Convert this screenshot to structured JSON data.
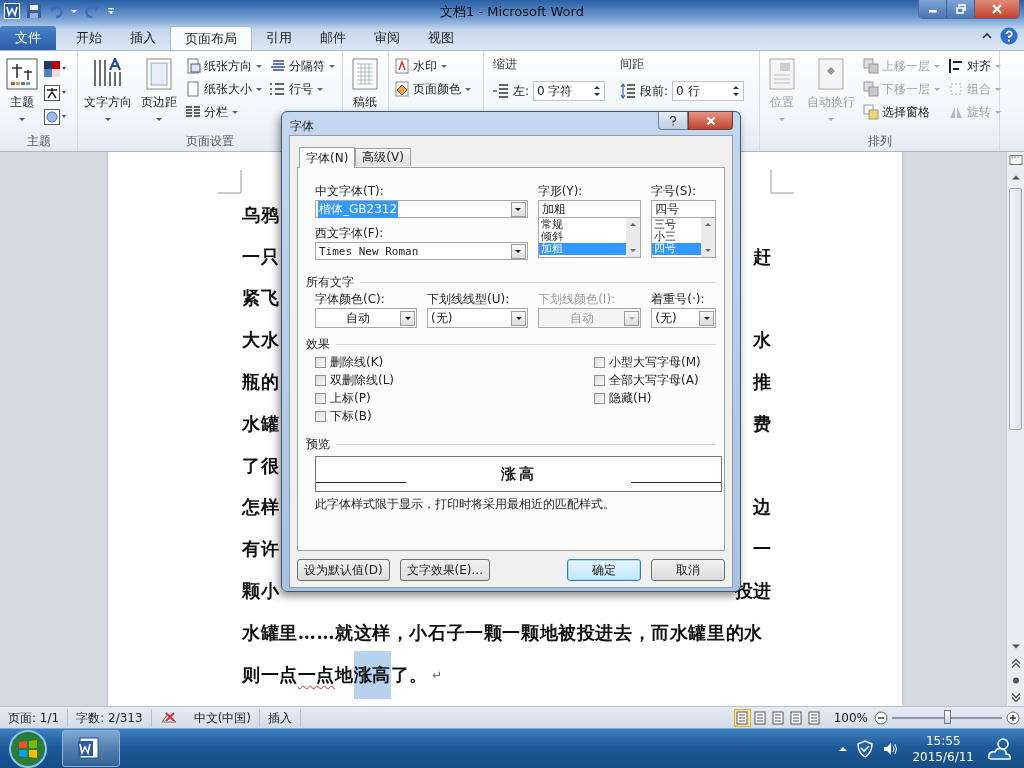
{
  "window": {
    "title": "文档1 - Microsoft Word"
  },
  "ribbon_tabs": [
    {
      "label": "文件",
      "kind": "file",
      "selected": false
    },
    {
      "label": "开始",
      "kind": "tab",
      "selected": false
    },
    {
      "label": "插入",
      "kind": "tab",
      "selected": false
    },
    {
      "label": "页面布局",
      "kind": "tab",
      "selected": true
    },
    {
      "label": "引用",
      "kind": "tab",
      "selected": false
    },
    {
      "label": "邮件",
      "kind": "tab",
      "selected": false
    },
    {
      "label": "审阅",
      "kind": "tab",
      "selected": false
    },
    {
      "label": "视图",
      "kind": "tab",
      "selected": false
    }
  ],
  "ribbon": {
    "themes": {
      "label": "主题",
      "button": "主题"
    },
    "page_setup": {
      "label": "页面设置",
      "large_buttons": [
        "文字方向",
        "页边距"
      ],
      "small_buttons": [
        "纸张方向",
        "纸张大小",
        "分栏",
        "分隔符",
        "行号"
      ]
    },
    "manuscript": {
      "button": "稿纸"
    },
    "page_background": {
      "small_buttons": [
        "水印",
        "页面颜色"
      ]
    },
    "paragraph": {
      "indent_label": "缩进",
      "indent_left": {
        "label": "左:",
        "value": "0 字符"
      },
      "spacing_label": "间距",
      "spacing_before": {
        "label": "段前:",
        "value": "0 行"
      }
    },
    "arrange": {
      "label": "排列",
      "large_buttons": [
        {
          "label": "位置",
          "disabled": true
        },
        {
          "label": "自动换行",
          "disabled": true
        }
      ],
      "small_buttons": [
        {
          "label": "上移一层",
          "disabled": true
        },
        {
          "label": "下移一层",
          "disabled": true
        },
        {
          "label": "选择窗格",
          "disabled": false
        },
        {
          "label": "对齐",
          "disabled": false
        },
        {
          "label": "组合",
          "disabled": true
        },
        {
          "label": "旋转",
          "disabled": true
        }
      ]
    }
  },
  "document": {
    "lines": [
      {
        "kind": "split",
        "left": "乌鸦"
      },
      {
        "kind": "split",
        "left": "一只",
        "right": "赶"
      },
      {
        "kind": "split",
        "left": "紧飞"
      },
      {
        "kind": "split",
        "left": "大水",
        "right": "水"
      },
      {
        "kind": "split",
        "left": "瓶的",
        "right": "推"
      },
      {
        "kind": "split",
        "left": "水罐",
        "right": "费"
      },
      {
        "kind": "split",
        "left": "了很"
      },
      {
        "kind": "split",
        "left": "怎样",
        "right": "边"
      },
      {
        "kind": "split",
        "left": "有许",
        "right": "一"
      },
      {
        "kind": "split",
        "left": "颗小",
        "right": "投进"
      },
      {
        "kind": "full",
        "text": "水罐里……就这样，小石子一颗一颗地被投进去，而水罐里的水"
      },
      {
        "kind": "segments",
        "segments": [
          {
            "text": "则一点",
            "selected": false,
            "misspelled": false
          },
          {
            "text": "一点",
            "selected": false,
            "misspelled": true
          },
          {
            "text": "地",
            "selected": false,
            "misspelled": false
          },
          {
            "text": "涨高",
            "selected": true,
            "misspelled": false
          },
          {
            "text": "了。",
            "selected": false,
            "misspelled": false
          }
        ],
        "paragraph_mark": "↵"
      }
    ]
  },
  "status_bar": {
    "page": "页面: 1/1",
    "words": "字数: 2/313",
    "language": "中文(中国)",
    "mode": "插入",
    "views": [
      {
        "selected": true
      },
      {
        "selected": false
      },
      {
        "selected": false
      },
      {
        "selected": false
      },
      {
        "selected": false
      }
    ],
    "zoom": "100%",
    "zoom_slider": {
      "level": 0.5
    }
  },
  "taskbar": {
    "time": "15:55",
    "date": "2015/6/11"
  },
  "dialog": {
    "title": "字体",
    "tabs": [
      {
        "label": "字体(N)",
        "selected": true
      },
      {
        "label": "高级(V)",
        "selected": false
      }
    ],
    "chinese_font": {
      "label": "中文字体(T):",
      "value": "楷体_GB2312",
      "value_selected": true
    },
    "western_font": {
      "label": "西文字体(F):",
      "value": "Times New Roman",
      "value_selected": false
    },
    "style": {
      "label": "字形(Y):",
      "value": "加粗",
      "options": [
        {
          "label": "常规",
          "selected": false
        },
        {
          "label": "倾斜",
          "selected": false
        },
        {
          "label": "加粗",
          "selected": true
        }
      ]
    },
    "size": {
      "label": "字号(S):",
      "value": "四号",
      "options": [
        {
          "label": "三号",
          "selected": false
        },
        {
          "label": "小三",
          "selected": false
        },
        {
          "label": "四号",
          "selected": true
        }
      ]
    },
    "all_text": {
      "heading": "所有文字",
      "fields": [
        {
          "label": "字体颜色(C):",
          "value": "自动",
          "disabled": false
        },
        {
          "label": "下划线线型(U):",
          "value": "(无)",
          "disabled": false
        },
        {
          "label": "下划线颜色(I):",
          "value": "自动",
          "disabled": true
        },
        {
          "label": "着重号(·):",
          "value": "(无)",
          "disabled": false
        }
      ]
    },
    "effects": {
      "heading": "效果",
      "options": [
        {
          "label": "删除线(K)",
          "checked": false
        },
        {
          "label": "双删除线(L)",
          "checked": false
        },
        {
          "label": "上标(P)",
          "checked": false
        },
        {
          "label": "下标(B)",
          "checked": false
        },
        {
          "label": "小型大写字母(M)",
          "checked": false
        },
        {
          "label": "全部大写字母(A)",
          "checked": false
        },
        {
          "label": "隐藏(H)",
          "checked": false
        }
      ]
    },
    "preview": {
      "heading": "预览",
      "sample": "涨高",
      "note": "此字体样式限于显示，打印时将采用最相近的匹配样式。"
    },
    "buttons": [
      {
        "label": "设为默认值(D)",
        "default": false
      },
      {
        "label": "文字效果(E)...",
        "default": false
      },
      {
        "label": "确定",
        "default": true
      },
      {
        "label": "取消",
        "default": false
      }
    ]
  }
}
